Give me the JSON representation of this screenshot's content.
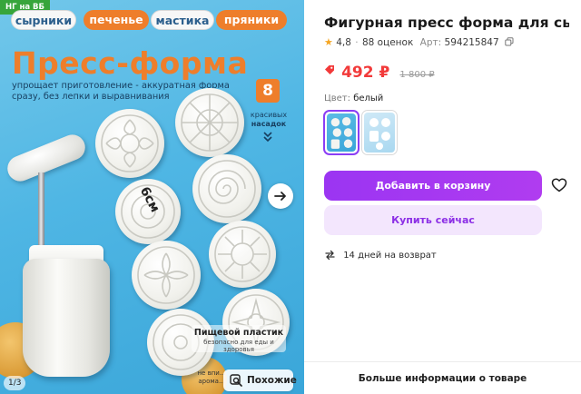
{
  "gallery": {
    "badge": "НГ на ВБ",
    "tags": [
      "сырники",
      "печенье",
      "мастика",
      "пряники"
    ],
    "hero_title": "Пресс-форма",
    "hero_subtitle": "упрощает приготовление - аккуратная форма сразу, без лепки и выравнивания",
    "nozzle_count": "8",
    "nozzle_label_1": "красивых",
    "nozzle_label_2": "насадок",
    "size_label": "6см",
    "info_title": "Пищевой пластик",
    "info_subtitle": "безопасно для еды и здоровья",
    "info2_text": "не впи... арома...",
    "page_counter": "1/3",
    "similar_label": "Похожие",
    "colors": {
      "background": "#4fb6e4",
      "accent": "#ee7e2b",
      "badge": "#37a53b"
    }
  },
  "product": {
    "title": "Фигурная пресс форма для сырн...",
    "rating": "4,8",
    "reviews": "88 оценок",
    "article_label": "Арт:",
    "article": "594215847",
    "price": "492 ₽",
    "old_price": "1 800 ₽",
    "color_label": "Цвет:",
    "color_value": "белый",
    "add_to_cart": "Добавить в корзину",
    "buy_now": "Купить сейчас",
    "returns": "14 дней на возврат",
    "more_info": "Больше информации о товаре",
    "colors": {
      "brand": "#9b35f2",
      "price": "#f23a3a",
      "buy_bg": "#f3e6fd"
    }
  }
}
